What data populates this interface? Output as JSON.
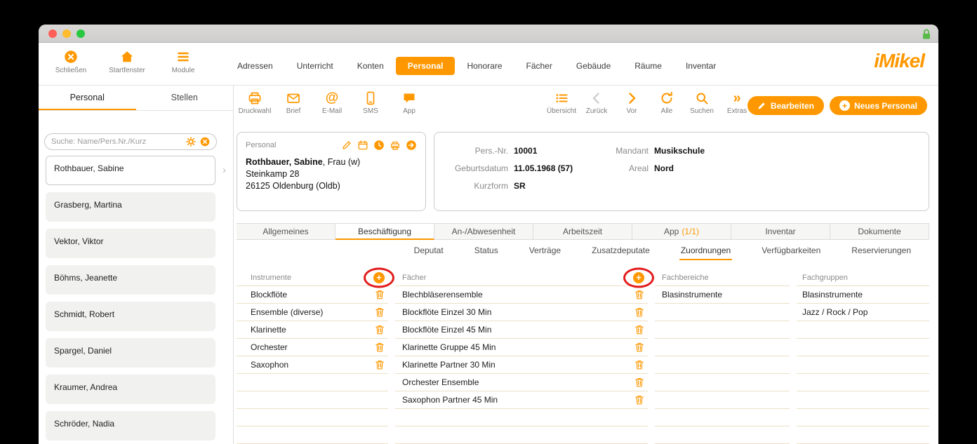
{
  "colors": {
    "accent": "#FF9800",
    "annotation": "#E21B1B",
    "lock": "#58B947"
  },
  "app_toolbar": {
    "left_buttons": [
      {
        "label": "Schließen"
      },
      {
        "label": "Startfenster"
      },
      {
        "label": "Module"
      }
    ],
    "nav_tabs": [
      {
        "label": "Adressen"
      },
      {
        "label": "Unterricht"
      },
      {
        "label": "Konten"
      },
      {
        "label": "Personal",
        "active": true
      },
      {
        "label": "Honorare"
      },
      {
        "label": "Fächer"
      },
      {
        "label": "Gebäude"
      },
      {
        "label": "Räume"
      },
      {
        "label": "Inventar"
      }
    ],
    "logo": "iMikel"
  },
  "sidebar": {
    "tabs": [
      {
        "label": "Personal",
        "active": true
      },
      {
        "label": "Stellen"
      }
    ],
    "search": {
      "placeholder": "Suche: Name/Pers.Nr./Kurz"
    },
    "people": [
      {
        "name": "Rothbauer, Sabine",
        "selected": true
      },
      {
        "name": "Grasberg, Martina"
      },
      {
        "name": "Vektor, Viktor"
      },
      {
        "name": "Böhms, Jeanette"
      },
      {
        "name": "Schmidt, Robert"
      },
      {
        "name": "Spargel, Daniel"
      },
      {
        "name": "Kraumer, Andrea"
      },
      {
        "name": "Schröder, Nadia"
      }
    ]
  },
  "action_bar": {
    "comm": [
      {
        "label": "Druckwahl"
      },
      {
        "label": "Brief"
      },
      {
        "label": "E-Mail"
      },
      {
        "label": "SMS"
      },
      {
        "label": "App"
      }
    ],
    "nav": [
      {
        "label": "Übersicht"
      },
      {
        "label": "Zurück",
        "disabled": true
      },
      {
        "label": "Vor"
      },
      {
        "label": "Alle"
      },
      {
        "label": "Suchen"
      },
      {
        "label": "Extras"
      }
    ],
    "edit_button": "Bearbeiten",
    "new_button": "Neues Personal"
  },
  "person_card": {
    "title": "Personal",
    "name": "Rothbauer, Sabine",
    "name_suffix": ", Frau (w)",
    "address_line1": "Steinkamp 28",
    "address_line2": "26125 Oldenburg (Oldb)"
  },
  "details_card": {
    "fields_left": [
      {
        "label": "Pers.-Nr.",
        "value": "10001"
      },
      {
        "label": "Geburtsdatum",
        "value": "11.05.1968 (57)"
      },
      {
        "label": "Kurzform",
        "value": "SR"
      }
    ],
    "fields_right": [
      {
        "label": "Mandant",
        "value": "Musikschule"
      },
      {
        "label": "Areal",
        "value": "Nord"
      }
    ]
  },
  "main_tabs": [
    {
      "label": "Allgemeines"
    },
    {
      "label": "Beschäftigung",
      "active": true
    },
    {
      "label": "An-/Abwesenheit"
    },
    {
      "label": "Arbeitszeit"
    },
    {
      "label": "App",
      "badge": "(1/1)"
    },
    {
      "label": "Inventar"
    },
    {
      "label": "Dokumente"
    }
  ],
  "sub_tabs": [
    {
      "label": "Deputat"
    },
    {
      "label": "Status"
    },
    {
      "label": "Verträge"
    },
    {
      "label": "Zusatzdeputate"
    },
    {
      "label": "Zuordnungen",
      "active": true
    },
    {
      "label": "Verfügbarkeiten"
    },
    {
      "label": "Reservierungen"
    }
  ],
  "assignments": {
    "instrumente": {
      "header": "Instrumente",
      "items": [
        "Blockflöte",
        "Ensemble (diverse)",
        "Klarinette",
        "Orchester",
        "Saxophon"
      ]
    },
    "faecher": {
      "header": "Fächer",
      "items": [
        "Blechbläserensemble",
        "Blockflöte Einzel 30 Min",
        "Blockflöte Einzel 45 Min",
        "Klarinette Gruppe 45 Min",
        "Klarinette Partner 30 Min",
        "Orchester Ensemble",
        "Saxophon Partner 45 Min"
      ]
    },
    "fachbereiche": {
      "header": "Fachbereiche",
      "items": [
        "Blasinstrumente"
      ]
    },
    "fachgruppen": {
      "header": "Fachgruppen",
      "items": [
        "Blasinstrumente",
        "Jazz / Rock / Pop"
      ]
    }
  }
}
